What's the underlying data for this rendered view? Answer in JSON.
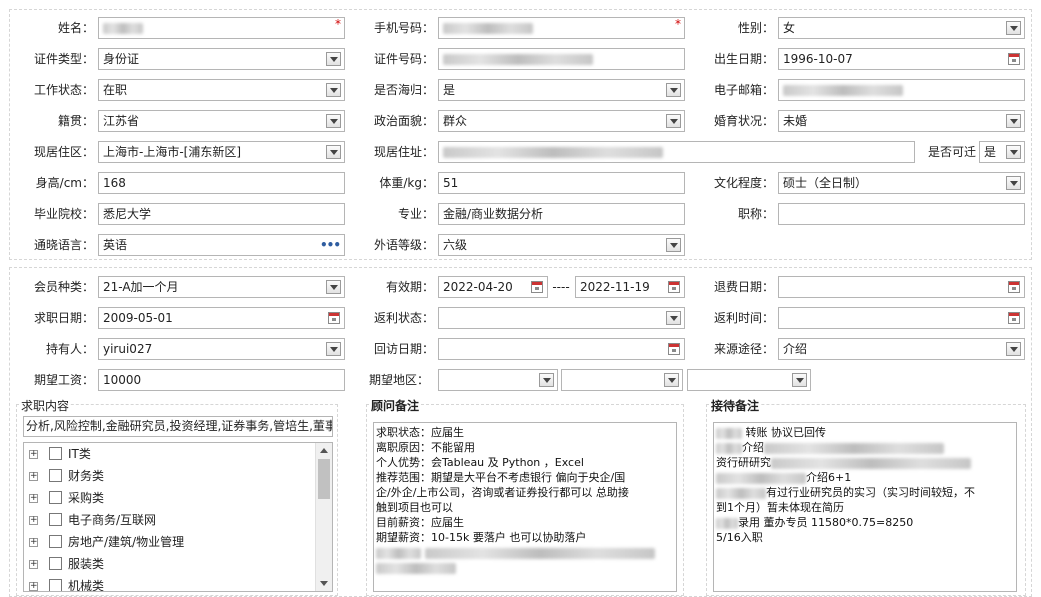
{
  "basic": {
    "name_label": "姓名：",
    "phone_label": "手机号码：",
    "gender_label": "性别：",
    "gender_value": "女",
    "id_type_label": "证件类型：",
    "id_type_value": "身份证",
    "id_no_label": "证件号码：",
    "birth_label": "出生日期：",
    "birth_value": "1996-10-07",
    "work_status_label": "工作状态：",
    "work_status_value": "在职",
    "overseas_label": "是否海归：",
    "overseas_value": "是",
    "email_label": "电子邮箱：",
    "origin_label": "籍贯：",
    "origin_value": "江苏省",
    "political_label": "政治面貌：",
    "political_value": "群众",
    "marital_label": "婚育状况：",
    "marital_value": "未婚",
    "residence_area_label": "现居住区：",
    "residence_area_value": "上海市-上海市-[浦东新区]",
    "residence_addr_label": "现居住址：",
    "relocate_label": "是否可迁",
    "relocate_value": "是",
    "height_label": "身高/cm：",
    "height_value": "168",
    "weight_label": "体重/kg：",
    "weight_value": "51",
    "education_label": "文化程度：",
    "education_value": "硕士（全日制）",
    "school_label": "毕业院校：",
    "school_value": "悉尼大学",
    "major_label": "专业：",
    "major_value": "金融/商业数据分析",
    "title_label": "职称：",
    "language_label": "通晓语言：",
    "language_value": "英语",
    "lang_level_label": "外语等级：",
    "lang_level_value": "六级",
    "required_mark": "*"
  },
  "member": {
    "type_label": "会员种类：",
    "type_value": "21-A加一个月",
    "valid_label": "有效期：",
    "valid_from": "2022-04-20",
    "valid_sep": "----",
    "valid_to": "2022-11-19",
    "refund_date_label": "退费日期：",
    "apply_date_label": "求职日期：",
    "apply_date_value": "2009-05-01",
    "rebate_status_label": "返利状态：",
    "rebate_time_label": "返利时间：",
    "holder_label": "持有人：",
    "holder_value": "yirui027",
    "visit_date_label": "回访日期：",
    "source_label": "来源途径：",
    "source_value": "介绍",
    "salary_label": "期望工资：",
    "salary_value": "10000",
    "region_label": "期望地区："
  },
  "job_content": {
    "title": "求职内容",
    "summary": "分析,风险控制,金融研究员,投资经理,证券事务,管培生,董事",
    "tree": [
      {
        "label": "IT类"
      },
      {
        "label": "财务类"
      },
      {
        "label": "采购类"
      },
      {
        "label": "电子商务/互联网"
      },
      {
        "label": "房地产/建筑/物业管理"
      },
      {
        "label": "服装类"
      },
      {
        "label": "机械类"
      }
    ]
  },
  "advisor_notes": {
    "title": "顾问备注",
    "lines": [
      "求职状态：应届生",
      "离职原因：不能留用",
      "个人优势：会Tableau 及 Python ，Excel",
      "推荐范围：期望是大平台不考虑银行   偏向于央企/国",
      "企/外企/上市公司，咨询或者证券投行都可以  总助接",
      "触到项目也可以",
      "目前薪资：应届生",
      "期望薪资：10-15k 要落户 也可以协助落户"
    ]
  },
  "reception_notes": {
    "title": "接待备注",
    "line1": "转账 协议已回传",
    "line2": "介绍",
    "line3": "资行研研究",
    "line4": "介绍6+1",
    "line5": "有过行业研究员的实习（实习时间较短，不",
    "line6": "到1个月）暂未体现在简历",
    "line7": "录用 董办专员  11580*0.75=8250",
    "line8": "5/16入职"
  }
}
